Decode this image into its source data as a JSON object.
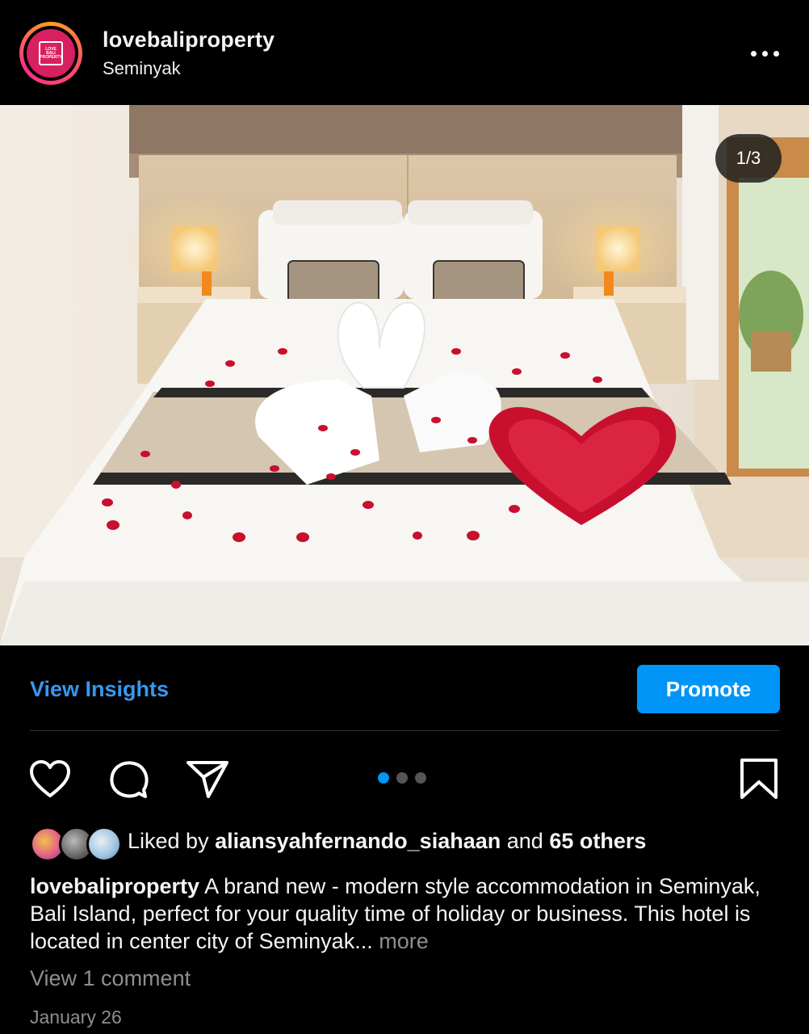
{
  "post": {
    "username": "lovebaliproperty",
    "location": "Seminyak",
    "avatar_logo_text": [
      "LOVE",
      "BALI",
      "PROPERTY"
    ],
    "image_counter": "1/3",
    "image_description_icon": "photo-bedroom",
    "carousel": {
      "total": 3,
      "active_index": 0
    }
  },
  "insights_row": {
    "view_insights_label": "View Insights",
    "promote_label": "Promote"
  },
  "actions": {
    "like_icon": "heart-icon",
    "comment_icon": "comment-icon",
    "share_icon": "send-icon",
    "save_icon": "bookmark-icon"
  },
  "likes": {
    "prefix": "Liked by",
    "user": "aliansyahfernando_siahaan",
    "connector": "and",
    "others": "65 others"
  },
  "caption": {
    "username": "lovebaliproperty",
    "text": "A brand new - modern style accommodation in Seminyak, Bali Island, perfect for your quality time of holiday or business. This hotel is located in center city of Seminyak...",
    "more_label": "more"
  },
  "comments_link": "View 1 comment",
  "date": "January 26",
  "colors": {
    "background": "#000000",
    "accent_blue": "#0095f6",
    "link_blue": "#3797f0",
    "muted_text": "#8e8e8e"
  }
}
